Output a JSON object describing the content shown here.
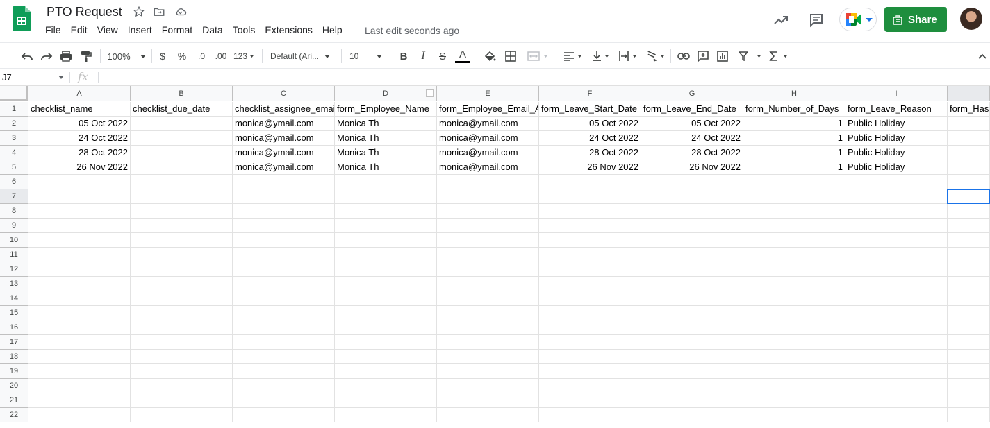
{
  "doc": {
    "title": "PTO Request",
    "last_edit": "Last edit seconds ago",
    "share_label": "Share"
  },
  "menu": [
    "File",
    "Edit",
    "View",
    "Insert",
    "Format",
    "Data",
    "Tools",
    "Extensions",
    "Help"
  ],
  "toolbar": {
    "zoom": "100%",
    "currency": "$",
    "percent": "%",
    "dec_decrease": ".0",
    "dec_increase": ".00",
    "more_formats": "123",
    "font": "Default (Ari...",
    "font_size": "10",
    "bold": "B",
    "italic": "I",
    "strike": "S",
    "text_color": "A"
  },
  "formula_bar": {
    "cell_ref": "J7",
    "fx": "fx"
  },
  "grid": {
    "columns": [
      "A",
      "B",
      "C",
      "D",
      "E",
      "F",
      "G",
      "H",
      "I",
      ""
    ],
    "rows": [
      "1",
      "2",
      "3",
      "4",
      "5",
      "6",
      "7",
      "8",
      "9",
      "10",
      "11",
      "12",
      "13",
      "14",
      "15",
      "16",
      "17",
      "18",
      "19",
      "20",
      "21",
      "22"
    ],
    "header_row": [
      "checklist_name",
      "checklist_due_date",
      "checklist_assignee_email",
      "form_Employee_Name",
      "form_Employee_Email_Address",
      "form_Leave_Start_Date",
      "form_Leave_End_Date",
      "form_Number_of_Days",
      "form_Leave_Reason",
      "form_Has"
    ],
    "data_rows": [
      [
        "05 Oct 2022",
        "",
        "monica@ymail.com",
        "Monica Th",
        "monica@ymail.com",
        "05 Oct 2022",
        "05 Oct 2022",
        "1",
        "Public Holiday",
        ""
      ],
      [
        "24 Oct 2022",
        "",
        "monica@ymail.com",
        "Monica Th",
        "monica@ymail.com",
        "24 Oct 2022",
        "24 Oct 2022",
        "1",
        "Public Holiday",
        ""
      ],
      [
        "28 Oct 2022",
        "",
        "monica@ymail.com",
        "Monica Th",
        "monica@ymail.com",
        "28 Oct 2022",
        "28 Oct 2022",
        "1",
        "Public Holiday",
        ""
      ],
      [
        "26 Nov 2022",
        "",
        "monica@ymail.com",
        "Monica Th",
        "monica@ymail.com",
        "26 Nov 2022",
        "26 Nov 2022",
        "1",
        "Public Holiday",
        ""
      ]
    ],
    "right_aligned_columns": [
      0,
      5,
      6,
      7
    ],
    "selected_cell": "J7"
  },
  "colors": {
    "share": "#1e8e3e",
    "selection": "#1a73e8",
    "sheets_green": "#0f9d58"
  }
}
